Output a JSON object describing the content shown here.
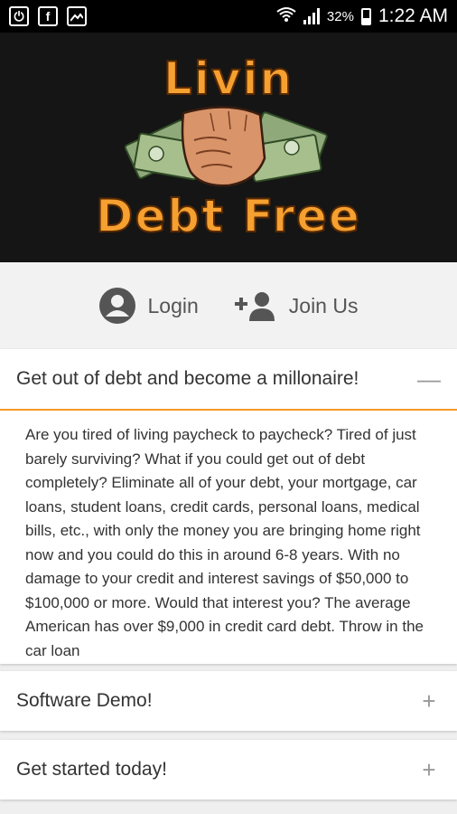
{
  "status_bar": {
    "battery": "32%",
    "time": "1:22 AM",
    "icons": [
      "power-icon",
      "facebook-icon",
      "image-icon",
      "wifi-icon",
      "signal-icon",
      "battery-icon"
    ]
  },
  "banner": {
    "logo_top": "Livin",
    "logo_bottom": "Debt Free"
  },
  "auth": {
    "login_label": "Login",
    "join_label": "Join Us"
  },
  "accordion": [
    {
      "title": "Get out of debt and become a millonaire!",
      "toggle": "—",
      "body": "Are you tired of living paycheck to paycheck? Tired of just barely surviving? What if you could get out of debt completely? Eliminate all of your debt, your mortgage, car loans, student loans, credit cards, personal loans, medical bills, etc., with only the money you are bringing home right now and you could do this in around 6-8 years. With no damage to your credit and interest savings of $50,000 to $100,000 or more. Would that interest you? The average American has over $9,000 in credit card debt. Throw in the car loan"
    },
    {
      "title": "Software Demo!",
      "toggle": "+"
    },
    {
      "title": "Get started today!",
      "toggle": "+"
    }
  ],
  "colors": {
    "accent": "#f59a2a",
    "logo": "#f5a030",
    "banner_bg": "#151515"
  }
}
